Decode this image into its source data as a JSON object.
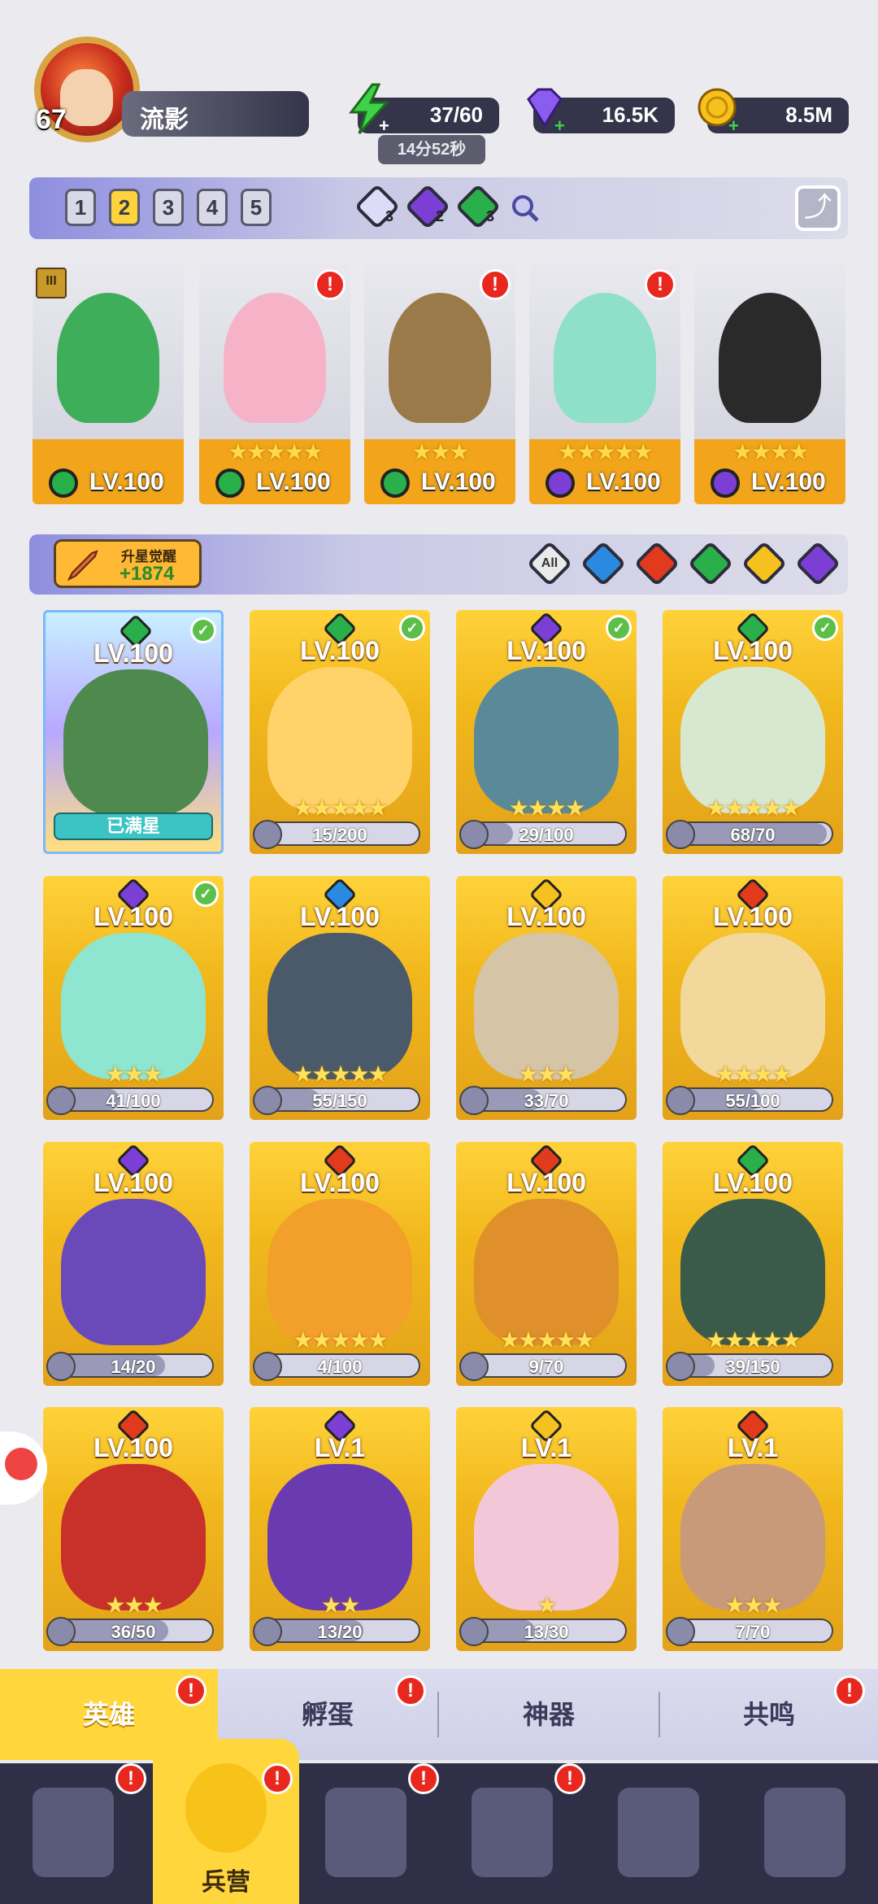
{
  "player": {
    "level": "67",
    "name": "流影"
  },
  "resources": {
    "energy": {
      "value": "37/60",
      "timer": "14分52秒",
      "icon": "lightning-icon",
      "color": "#3ed24a"
    },
    "gems": {
      "value": "16.5K",
      "icon": "diamond-icon",
      "color": "#8a5cf0"
    },
    "gold": {
      "value": "8.5M",
      "icon": "coin-icon",
      "color": "#f5c11e"
    }
  },
  "team_bar": {
    "slots": [
      "1",
      "2",
      "3",
      "4",
      "5"
    ],
    "active_slot": "2",
    "element_counts": [
      {
        "element": "light",
        "count": "3",
        "color": "#dcdcf8"
      },
      {
        "element": "dark",
        "count": "2",
        "color": "#7b3fd6"
      },
      {
        "element": "nature",
        "count": "3",
        "color": "#2ab04a"
      }
    ]
  },
  "team_cards": [
    {
      "level": "LV.100",
      "element": "nature",
      "elem_color": "#2ab04a",
      "stars": "",
      "rank": "III",
      "alert": false,
      "color": "#3fae5a"
    },
    {
      "level": "LV.100",
      "element": "nature",
      "elem_color": "#2ab04a",
      "stars": "★★★★★",
      "alert": true,
      "color": "#f6b3c8"
    },
    {
      "level": "LV.100",
      "element": "nature",
      "elem_color": "#2ab04a",
      "stars": "★★★",
      "alert": true,
      "color": "#9b7a4a"
    },
    {
      "level": "LV.100",
      "element": "dark",
      "elem_color": "#7b3fd6",
      "stars": "★★★★★",
      "alert": true,
      "color": "#8fe0c8"
    },
    {
      "level": "LV.100",
      "element": "dark",
      "elem_color": "#7b3fd6",
      "stars": "★★★★",
      "alert": false,
      "color": "#2a2a2a"
    }
  ],
  "filter_bar": {
    "upgrade_label": "升星觉醒",
    "upgrade_value": "+1874",
    "filters": [
      {
        "label": "All",
        "color": "#eaeaea"
      },
      {
        "label": "water",
        "color": "#2a8ae0"
      },
      {
        "label": "fire",
        "color": "#e23a1c"
      },
      {
        "label": "nature",
        "color": "#2ab04a"
      },
      {
        "label": "light",
        "color": "#f5c11e"
      },
      {
        "label": "dark",
        "color": "#7b3fd6"
      }
    ]
  },
  "heroes": [
    {
      "level": "LV.100",
      "elem_color": "#2ab04a",
      "progress": "已满星",
      "fill": 1.0,
      "maxed": true,
      "check": true,
      "stars": "",
      "color": "#4e8a4e"
    },
    {
      "level": "LV.100",
      "elem_color": "#2ab04a",
      "progress": "15/200",
      "fill": 0.075,
      "check": true,
      "stars": "★★★★★",
      "color": "#ffd36a"
    },
    {
      "level": "LV.100",
      "elem_color": "#7b3fd6",
      "progress": "29/100",
      "fill": 0.29,
      "check": true,
      "stars": "★★★★",
      "color": "#5a8a9a"
    },
    {
      "level": "LV.100",
      "elem_color": "#2ab04a",
      "progress": "68/70",
      "fill": 0.97,
      "check": true,
      "stars": "★★★★★",
      "color": "#d8e8d0"
    },
    {
      "level": "LV.100",
      "elem_color": "#7b3fd6",
      "progress": "41/100",
      "fill": 0.41,
      "check": true,
      "stars": "★★★",
      "color": "#8fe6d0"
    },
    {
      "level": "LV.100",
      "elem_color": "#2a8ae0",
      "progress": "55/150",
      "fill": 0.37,
      "check": false,
      "stars": "★★★★★",
      "color": "#4a5a6a"
    },
    {
      "level": "LV.100",
      "elem_color": "#f5c11e",
      "progress": "33/70",
      "fill": 0.47,
      "check": false,
      "stars": "★★★",
      "color": "#d6c4a6"
    },
    {
      "level": "LV.100",
      "elem_color": "#e23a1c",
      "progress": "55/100",
      "fill": 0.55,
      "check": false,
      "stars": "★★★★",
      "color": "#f2d89a"
    },
    {
      "level": "LV.100",
      "elem_color": "#7b3fd6",
      "progress": "14/20",
      "fill": 0.7,
      "check": false,
      "stars": "",
      "color": "#6a4ab8"
    },
    {
      "level": "LV.100",
      "elem_color": "#e23a1c",
      "progress": "4/100",
      "fill": 0.04,
      "check": false,
      "stars": "★★★★★",
      "color": "#f2a02a"
    },
    {
      "level": "LV.100",
      "elem_color": "#e23a1c",
      "progress": "9/70",
      "fill": 0.13,
      "check": false,
      "stars": "★★★★★",
      "color": "#e0902a"
    },
    {
      "level": "LV.100",
      "elem_color": "#2ab04a",
      "progress": "39/150",
      "fill": 0.26,
      "check": false,
      "stars": "★★★★★",
      "color": "#3a5a4a"
    },
    {
      "level": "LV.100",
      "elem_color": "#e23a1c",
      "progress": "36/50",
      "fill": 0.72,
      "check": false,
      "stars": "★★★",
      "color": "#c8302a"
    },
    {
      "level": "LV.1",
      "elem_color": "#7b3fd6",
      "progress": "13/20",
      "fill": 0.65,
      "check": false,
      "stars": "★★",
      "color": "#6a3ab0"
    },
    {
      "level": "LV.1",
      "elem_color": "#f5c11e",
      "progress": "13/30",
      "fill": 0.43,
      "check": false,
      "stars": "★",
      "color": "#f2c8d8"
    },
    {
      "level": "LV.1",
      "elem_color": "#e23a1c",
      "progress": "7/70",
      "fill": 0.1,
      "check": false,
      "stars": "★★★",
      "color": "#c89a7a"
    }
  ],
  "sub_tabs": [
    {
      "label": "英雄",
      "active": true,
      "alert": true
    },
    {
      "label": "孵蛋",
      "active": false,
      "alert": true
    },
    {
      "label": "神器",
      "active": false,
      "alert": false
    },
    {
      "label": "共鸣",
      "active": false,
      "alert": true
    }
  ],
  "nav": [
    {
      "icon": "cards-icon",
      "alert": true
    },
    {
      "icon": "barracks-icon",
      "label": "兵营",
      "active": true,
      "alert": true
    },
    {
      "icon": "map-icon",
      "alert": true
    },
    {
      "icon": "castle-icon",
      "alert": true
    },
    {
      "icon": "mushroom-icon",
      "alert": false
    },
    {
      "icon": "guild-banner-icon",
      "alert": false
    }
  ],
  "alert_glyph": "!",
  "check_glyph": "✓",
  "share_glyph": "⤴"
}
